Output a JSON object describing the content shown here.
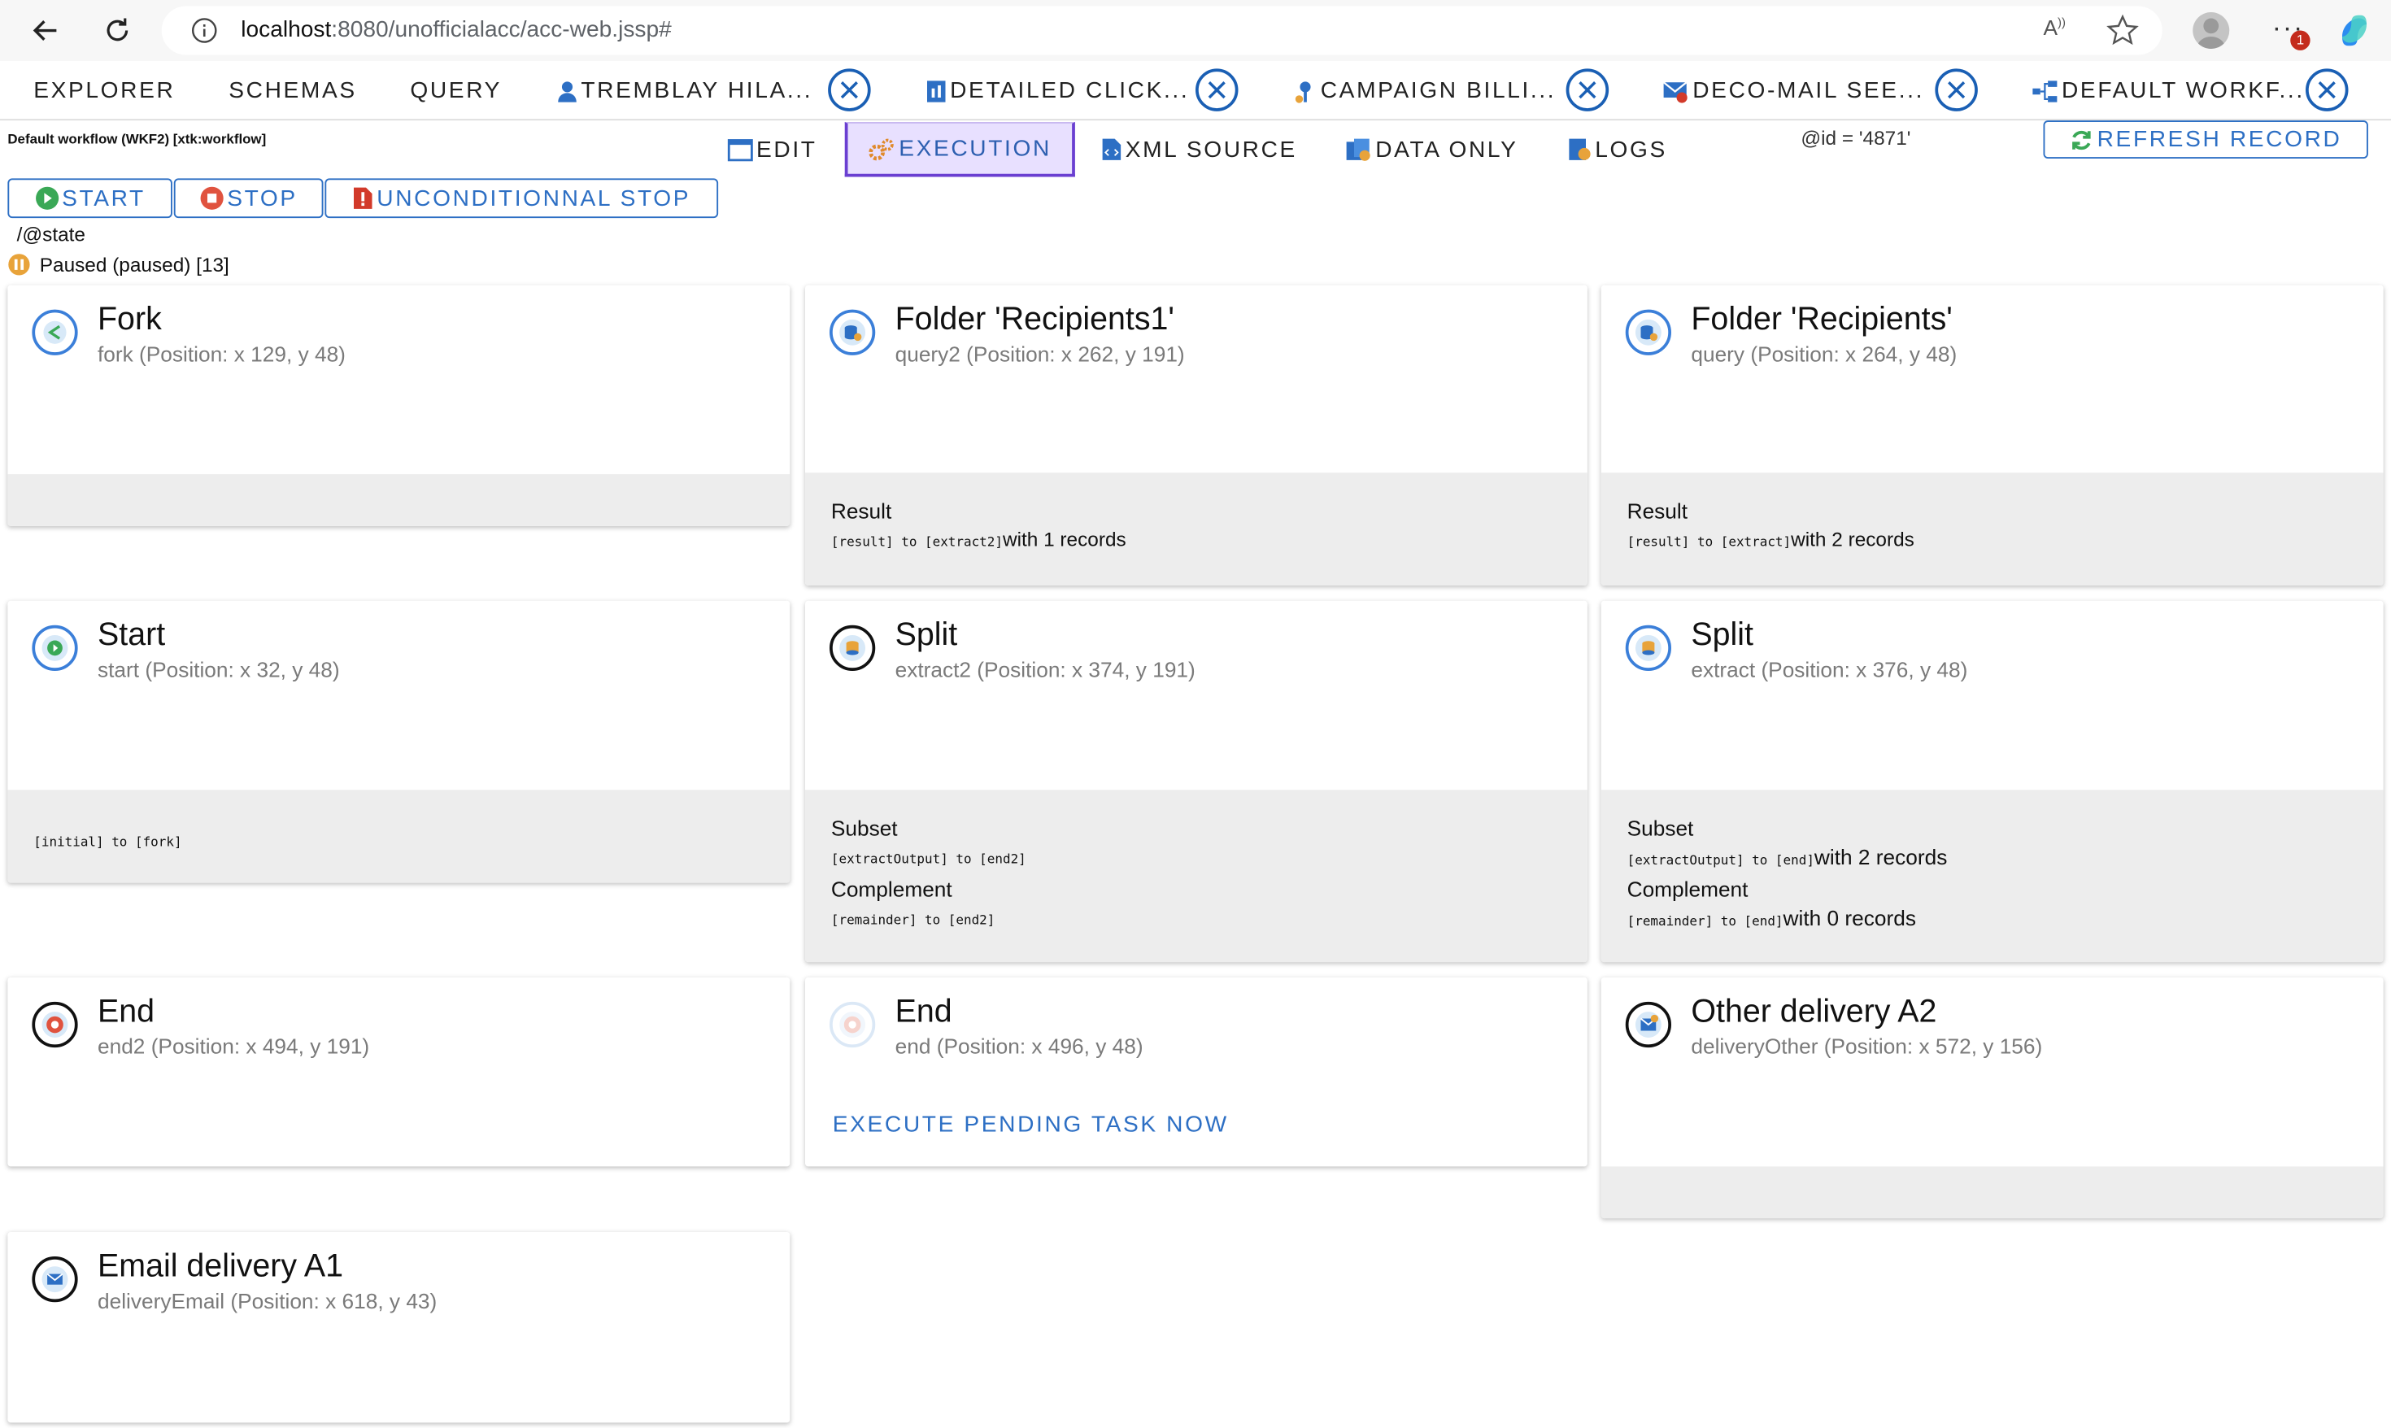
{
  "browser": {
    "url_host": "localhost",
    "url_rest": ":8080/unofficialacc/acc-web.jssp#",
    "badge": "1"
  },
  "app_tabs": [
    "EXPLORER",
    "SCHEMAS",
    "QUERY"
  ],
  "record_tabs": [
    {
      "label": "TREMBLAY HILA...",
      "icon": "person-icon"
    },
    {
      "label": "DETAILED CLICK...",
      "icon": "report-icon"
    },
    {
      "label": "CAMPAIGN BILLI...",
      "icon": "billing-icon"
    },
    {
      "label": "DECO-MAIL SEE...",
      "icon": "mail-error-icon"
    },
    {
      "label": "DEFAULT WORKF...",
      "icon": "workflow-icon"
    }
  ],
  "workflow_title": "Default workflow (WKF2) [xtk:workflow]",
  "view_tabs": {
    "edit": "EDIT",
    "execution": "EXECUTION",
    "xml_source": "XML SOURCE",
    "data_only": "DATA ONLY",
    "logs": "LOGS"
  },
  "record_id": "@id = '4871'",
  "refresh_label": "REFRESH RECORD",
  "actions": {
    "start": "START",
    "stop": "STOP",
    "unconditional_stop": "UNCONDITIONNAL STOP"
  },
  "state_path": "/@state",
  "status_text": "Paused (paused) [13]",
  "colors": {
    "accent_blue": "#2d6fc4",
    "active_tab_bg": "#e8e0ff",
    "active_tab_border": "#6a3fd1",
    "paused_orange": "#e8a33a"
  },
  "activities": {
    "fork": {
      "title": "Fork",
      "sub": "fork (Position: x 129, y 48)"
    },
    "query2": {
      "title": "Folder 'Recipients1'",
      "sub": "query2 (Position: x 262, y 191)",
      "result_label": "Result",
      "t1_code": "[result] to [extract2]",
      "t1_text": "with 1 records"
    },
    "query": {
      "title": "Folder 'Recipients'",
      "sub": "query (Position: x 264, y 48)",
      "result_label": "Result",
      "t1_code": "[result] to [extract]",
      "t1_text": "with 2 records"
    },
    "start": {
      "title": "Start",
      "sub": "start (Position: x 32, y 48)",
      "t1_code": "[initial] to [fork]"
    },
    "extract2": {
      "title": "Split",
      "sub": "extract2 (Position: x 374, y 191)",
      "l1": "Subset",
      "t1_code": "[extractOutput] to [end2]",
      "l2": "Complement",
      "t2_code": "[remainder] to [end2]"
    },
    "extract": {
      "title": "Split",
      "sub": "extract (Position: x 376, y 48)",
      "l1": "Subset",
      "t1_code": "[extractOutput] to [end]",
      "t1_text": "with 2 records",
      "l2": "Complement",
      "t2_code": "[remainder] to [end]",
      "t2_text": "with 0 records"
    },
    "end2": {
      "title": "End",
      "sub": "end2 (Position: x 494, y 191)"
    },
    "end": {
      "title": "End",
      "sub": "end (Position: x 496, y 48)",
      "action": "EXECUTE PENDING TASK NOW"
    },
    "deliveryOther": {
      "title": "Other delivery A2",
      "sub": "deliveryOther (Position: x 572, y 156)"
    },
    "deliveryEmail": {
      "title": "Email delivery A1",
      "sub": "deliveryEmail (Position: x 618, y 43)"
    }
  }
}
